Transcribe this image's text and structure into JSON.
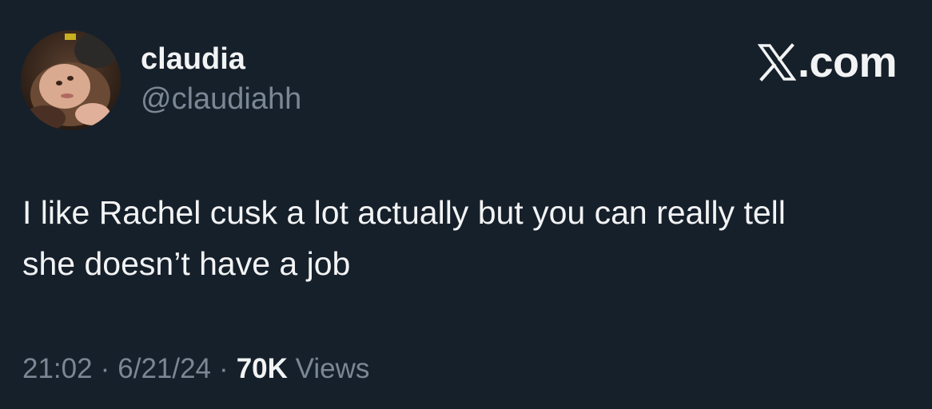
{
  "user": {
    "display_name": "claudia",
    "handle": "@claudiahh",
    "avatar_icon": "profile-photo"
  },
  "brand": {
    "icon": "x-logo-icon",
    "site": "𝕏.com",
    "site_text": ".com"
  },
  "tweet": {
    "text": "I like Rachel cusk a lot actually but you can really tell\nshe doesn’t have a job"
  },
  "meta": {
    "time": "21:02",
    "separator": "·",
    "date": "6/21/24",
    "views_count": "70K",
    "views_label": "Views"
  },
  "colors": {
    "background": "#16202b",
    "primary_text": "#f2f3f4",
    "secondary_text": "#7b8794"
  }
}
